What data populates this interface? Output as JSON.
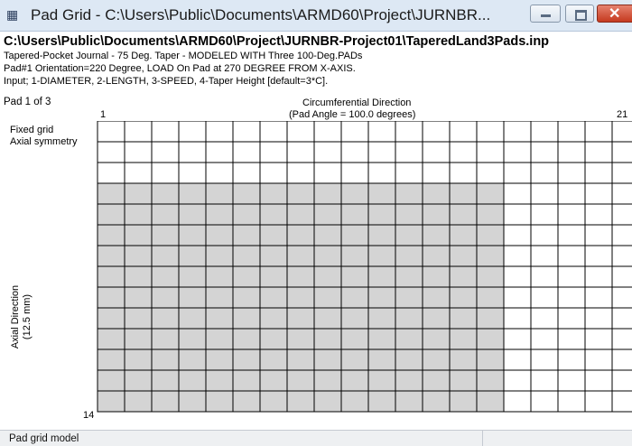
{
  "window": {
    "icon": "grid-icon",
    "title": "Pad Grid - C:\\Users\\Public\\Documents\\ARMD60\\Project\\JURNBR...",
    "controls": [
      "minimize-icon",
      "maximize-icon",
      "close-icon"
    ],
    "close_glyph": "✕"
  },
  "header": {
    "file_path": "C:\\Users\\Public\\Documents\\ARMD60\\Project\\JURNBR-Project01\\TaperedLand3Pads.inp",
    "line1": "Tapered-Pocket Journal - 75 Deg. Taper - MODELED WITH Three 100-Deg.PADs",
    "line2": "Pad#1 Orientation=220 Degree, LOAD On Pad at 270 DEGREE FROM X-AXIS.",
    "line3": "Input; 1-DIAMETER, 2-LENGTH, 3-SPEED, 4-Taper Height [default=3*C]."
  },
  "grid": {
    "pad_label": "Pad 1 of 3",
    "circumferential_title": "Circumferential Direction",
    "pad_angle": "(Pad Angle = 100.0 degrees)",
    "col_start": "1",
    "col_end": "21",
    "fixed_grid": "Fixed grid",
    "axial_symmetry": "Axial symmetry",
    "axial_direction": "Axial Direction",
    "axial_length": "(12.5 mm)",
    "row_end": "14",
    "columns": 21,
    "rows": 14,
    "visible_columns": 20,
    "tapered_columns": 15,
    "shaded_from_row": 4,
    "fill_colors": {
      "tapered": "#d4d4d4",
      "land": "#ffffff",
      "line": "#000000"
    }
  },
  "status": {
    "text": "Pad grid model"
  }
}
